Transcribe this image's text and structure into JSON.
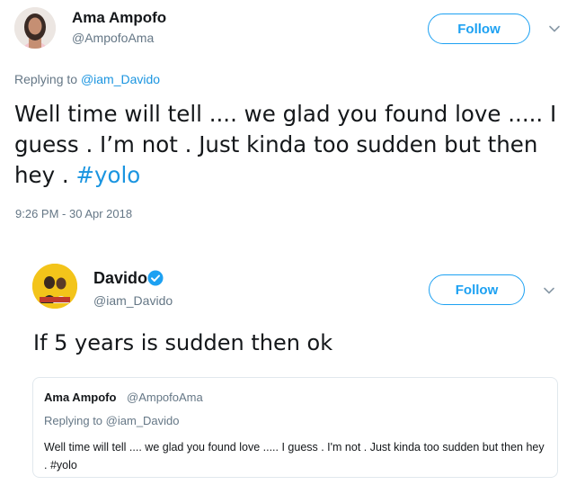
{
  "tweet1": {
    "name": "Ama Ampofo",
    "handle": "@AmpofoAma",
    "follow_label": "Follow",
    "replying_prefix": "Replying to",
    "replying_to": "@iam_Davido",
    "text": "Well time will tell .... we glad you found love ..... I guess . I’m not . Just kinda too sudden but then hey . ",
    "hashtag": "#yolo",
    "timestamp": "9:26 PM - 30 Apr 2018"
  },
  "tweet2": {
    "name": "Davido",
    "handle": "@iam_Davido",
    "verified_icon": "verified-badge-icon",
    "follow_label": "Follow",
    "text": "If 5 years is sudden then ok",
    "quoted": {
      "name": "Ama Ampofo",
      "handle": "@AmpofoAma",
      "replying_prefix": "Replying to",
      "replying_to": "@iam_Davido",
      "text": "Well time will tell .... we glad you found love ..... I guess . I'm not . Just kinda too sudden but then hey . #yolo"
    }
  },
  "colors": {
    "accent": "#1da1f2",
    "link": "#1b95e0",
    "muted": "#657786",
    "text": "#14171a",
    "border": "#e1e8ed"
  }
}
